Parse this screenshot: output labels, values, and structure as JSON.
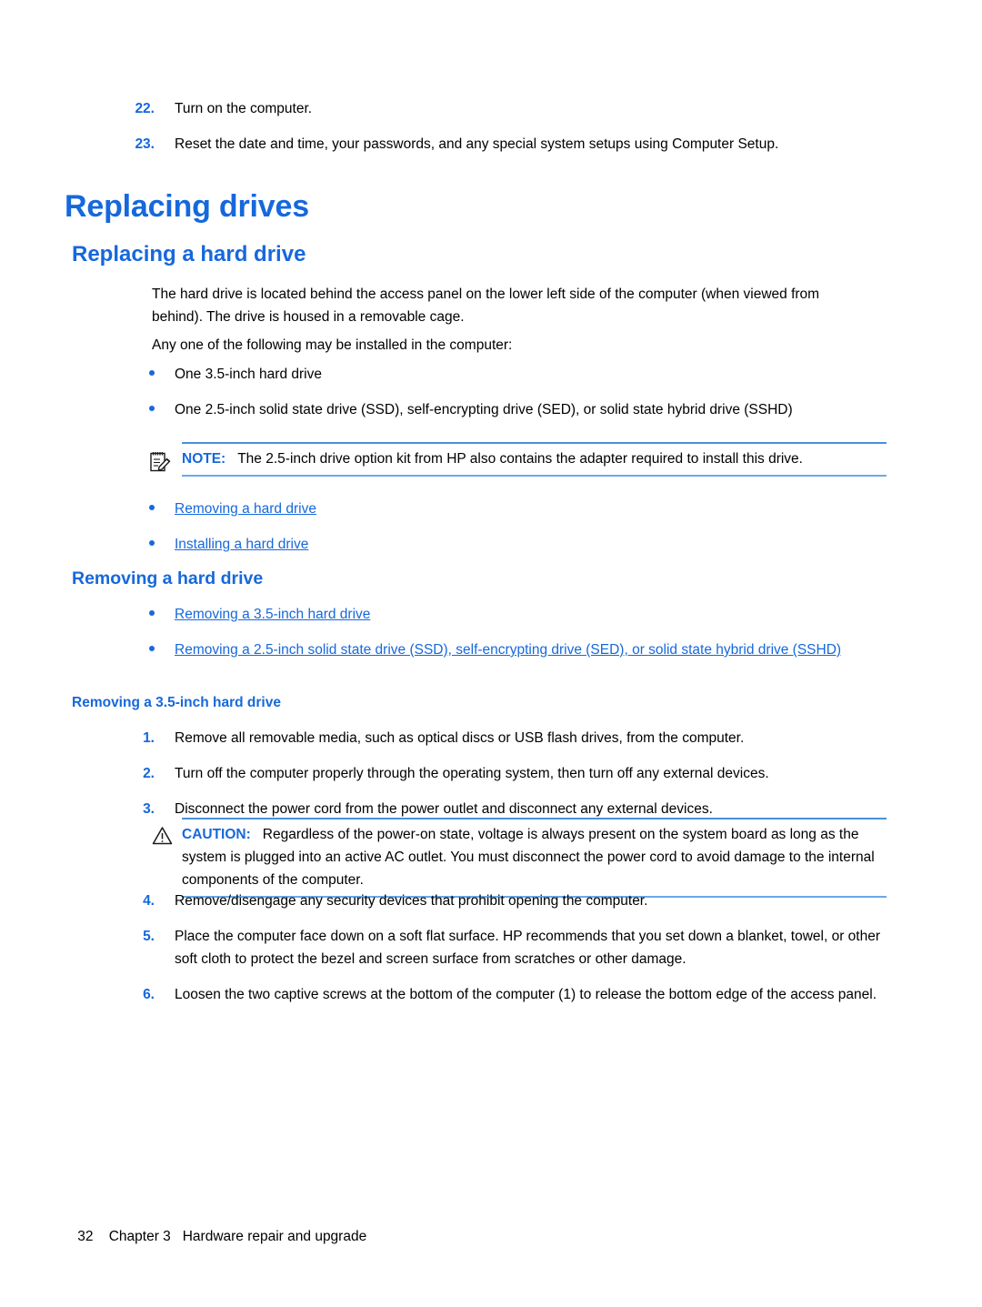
{
  "document": {
    "continued_steps": [
      {
        "number": "22.",
        "text": "Turn on the computer."
      },
      {
        "number": "23.",
        "text": "Reset the date and time, your passwords, and any special system setups using Computer Setup."
      }
    ],
    "title": "Replacing drives",
    "section": {
      "heading": "Replacing a hard drive",
      "intro_paragraph": "The hard drive is located behind the access panel on the lower left side of the computer (when viewed from behind). The drive is housed in a removable cage.",
      "lead_in": "Any one of the following may be installed in the computer:",
      "drive_options": [
        "One 3.5-inch hard drive",
        "One 2.5-inch solid state drive (SSD), self-encrypting drive (SED), or solid state hybrid drive (SSHD)"
      ],
      "note": {
        "icon": "note-clipboard-pencil-icon",
        "label": "NOTE:",
        "text": "The 2.5-inch drive option kit from HP also contains the adapter required to install this drive."
      },
      "links": [
        "Removing a hard drive",
        "Installing a hard drive"
      ]
    },
    "subsection": {
      "heading": "Removing a hard drive",
      "links": [
        "Removing a 3.5-inch hard drive",
        "Removing a 2.5-inch solid state drive (SSD), self-encrypting drive (SED), or solid state hybrid drive (SSHD)"
      ],
      "procedure_heading": "Removing a 3.5-inch hard drive",
      "steps_before_caution": [
        {
          "number": "1.",
          "text": "Remove all removable media, such as optical discs or USB flash drives, from the computer."
        },
        {
          "number": "2.",
          "text": "Turn off the computer properly through the operating system, then turn off any external devices."
        },
        {
          "number": "3.",
          "text": "Disconnect the power cord from the power outlet and disconnect any external devices."
        }
      ],
      "caution": {
        "icon": "warning-triangle-icon",
        "label": "CAUTION:",
        "text": "Regardless of the power-on state, voltage is always present on the system board as long as the system is plugged into an active AC outlet. You must disconnect the power cord to avoid damage to the internal components of the computer."
      },
      "steps_after_caution": [
        {
          "number": "4.",
          "text": "Remove/disengage any security devices that prohibit opening the computer."
        },
        {
          "number": "5.",
          "text": "Place the computer face down on a soft flat surface. HP recommends that you set down a blanket, towel, or other soft cloth to protect the bezel and screen surface from scratches or other damage."
        },
        {
          "number": "6.",
          "text": "Loosen the two captive screws at the bottom of the computer (1) to release the bottom edge of the access panel."
        }
      ]
    },
    "footer": {
      "page_number": "32",
      "chapter": "Chapter 3",
      "chapter_title": "Hardware repair and upgrade"
    },
    "colors": {
      "accent_blue": "#1668dc",
      "rule_blue": "#6aa9e9",
      "text_black": "#000000",
      "page_background": "#ffffff"
    }
  }
}
